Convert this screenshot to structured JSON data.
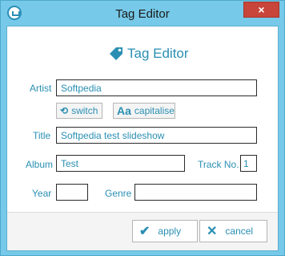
{
  "window": {
    "title": "Tag Editor",
    "close_glyph": "×"
  },
  "header": {
    "title": "Tag Editor",
    "icon": "tag-icon"
  },
  "fields": {
    "artist": {
      "label": "Artist",
      "value": "Softpedia"
    },
    "title": {
      "label": "Title",
      "value": "Softpedia test slideshow"
    },
    "album": {
      "label": "Album",
      "value": "Test"
    },
    "track": {
      "label": "Track No.",
      "value": "1"
    },
    "year": {
      "label": "Year",
      "value": ""
    },
    "genre": {
      "label": "Genre",
      "value": ""
    }
  },
  "buttons": {
    "switch": {
      "label": "switch",
      "icon": "switch-icon"
    },
    "capitalise": {
      "label": "capitalise",
      "icon_text": "Aa"
    },
    "apply": {
      "label": "apply",
      "icon": "check-icon"
    },
    "cancel": {
      "label": "cancel",
      "icon": "cancel-icon"
    }
  },
  "colors": {
    "accent": "#2a8fb3",
    "frame": "#76c9e8",
    "close": "#c7453a"
  }
}
